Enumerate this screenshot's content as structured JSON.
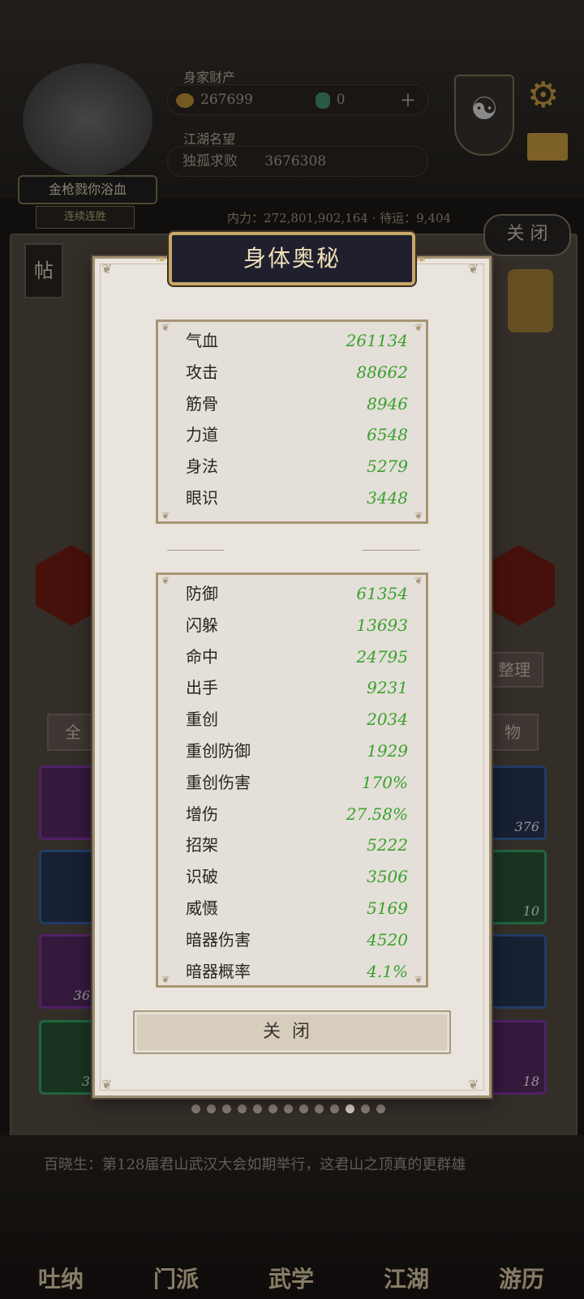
{
  "header": {
    "assets_label": "身家财产",
    "coins": "267699",
    "jade": "0",
    "rank_label": "江湖名望",
    "rank_title": "独孤求败",
    "rank_value": "3676308",
    "player_name": "金枪戮你浴血",
    "level_label": "连续连胜",
    "power_line": "内力：272,801,902,164  ·  待运：9,404",
    "close_label": "关 闭",
    "tie_label": "帖"
  },
  "modal": {
    "title": "身体奥秘",
    "primary_stats": [
      {
        "label": "气血",
        "value": "261134"
      },
      {
        "label": "攻击",
        "value": "88662"
      },
      {
        "label": "筋骨",
        "value": "8946"
      },
      {
        "label": "力道",
        "value": "6548"
      },
      {
        "label": "身法",
        "value": "5279"
      },
      {
        "label": "眼识",
        "value": "3448"
      }
    ],
    "secondary_stats": [
      {
        "label": "防御",
        "value": "61354"
      },
      {
        "label": "闪躲",
        "value": "13693"
      },
      {
        "label": "命中",
        "value": "24795"
      },
      {
        "label": "出手",
        "value": "9231"
      },
      {
        "label": "重创",
        "value": "2034"
      },
      {
        "label": "重创防御",
        "value": "1929"
      },
      {
        "label": "重创伤害",
        "value": "170%"
      },
      {
        "label": "增伤",
        "value": "27.58%"
      },
      {
        "label": "招架",
        "value": "5222"
      },
      {
        "label": "识破",
        "value": "3506"
      },
      {
        "label": "威慑",
        "value": "5169"
      },
      {
        "label": "暗器伤害",
        "value": "4520"
      },
      {
        "label": "暗器概率",
        "value": "4.1%"
      }
    ],
    "close_label": "关闭"
  },
  "background": {
    "tab_all": "全",
    "tab_items": "物",
    "organize": "整理",
    "slots_left": [
      {
        "count": ""
      },
      {
        "count": ""
      },
      {
        "count": "36"
      },
      {
        "count": "3"
      }
    ],
    "slots_right": [
      {
        "count": "376"
      },
      {
        "count": "10"
      },
      {
        "count": ""
      },
      {
        "count": "18"
      }
    ],
    "news": "百晓生：第128届君山武汉大会如期举行，这君山之顶真的更群雄",
    "nav": [
      "吐纳",
      "门派",
      "武学",
      "江湖",
      "游历"
    ],
    "pager_total": 13,
    "pager_active": 10
  },
  "colors": {
    "stat_value": "#3aa12e",
    "title_plate": "#1f1f2e",
    "title_border": "#c8a868"
  }
}
